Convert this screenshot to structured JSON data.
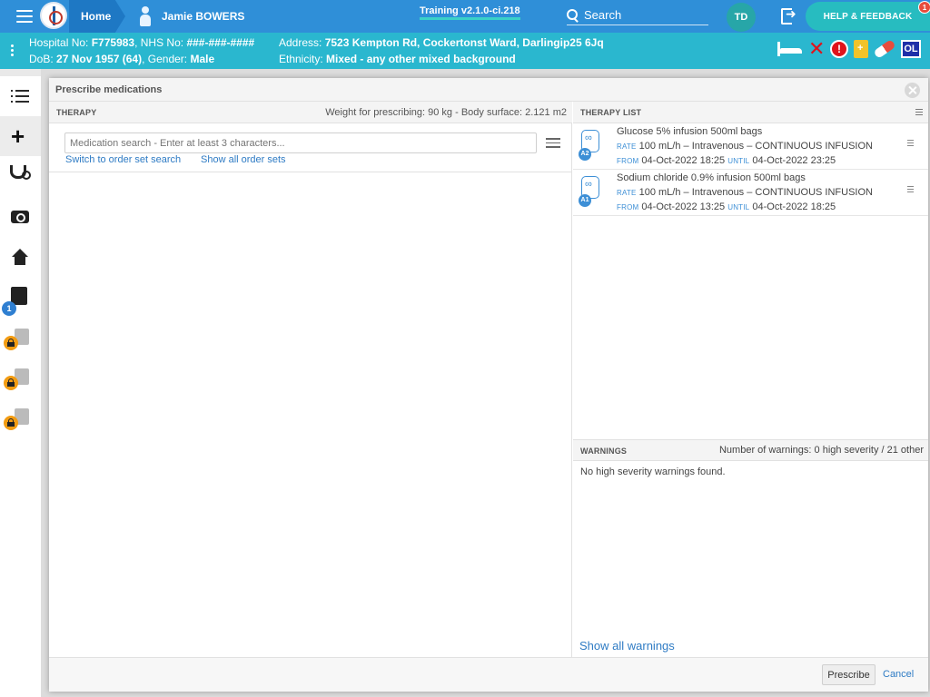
{
  "topbar": {
    "home_label": "Home",
    "patient_name": "Jamie BOWERS",
    "training_label": "Training v2.1.0-ci.218",
    "search_label": "Search",
    "avatar_initials": "TD",
    "help_label": "HELP & FEEDBACK",
    "help_badge": "1"
  },
  "banner": {
    "hospital_no_label": "Hospital No:",
    "hospital_no": "F775983",
    "nhs_no_label": "NHS No:",
    "nhs_no": "###-###-####",
    "address_label": "Address:",
    "address": "7523 Kempton Rd, Cockertonst Ward, Darlingip25 6Jq",
    "dob_label": "DoB:",
    "dob": "27 Nov 1957 (64)",
    "gender_label": "Gender:",
    "gender": "Male",
    "ethnicity_label": "Ethnicity:",
    "ethnicity": "Mixed - any other mixed background",
    "alert_symbol": "!",
    "ol_badge": "OL"
  },
  "rail": {
    "notes_badge": "1"
  },
  "modal": {
    "title": "Prescribe medications",
    "therapy_header": "THERAPY",
    "weight_text": "Weight for prescribing: 90 kg - Body surface: 2.121 m2",
    "search_placeholder": "Medication search - Enter at least 3 characters...",
    "order_set_link": "Switch to order set search",
    "show_sets_link": "Show all order sets",
    "therapy_list_header": "THERAPY LIST",
    "therapies": [
      {
        "badge": "A2",
        "name": "Glucose 5% infusion 500ml bags",
        "rate_label": "RATE",
        "rate": "100 mL/h – Intravenous – CONTINUOUS INFUSION",
        "from_label": "FROM",
        "from": "04-Oct-2022 18:25",
        "until_label": "UNTIL",
        "until": "04-Oct-2022 23:25"
      },
      {
        "badge": "A1",
        "name": "Sodium chloride 0.9% infusion 500ml bags",
        "rate_label": "RATE",
        "rate": "100 mL/h – Intravenous – CONTINUOUS INFUSION",
        "from_label": "FROM",
        "from": "04-Oct-2022 13:25",
        "until_label": "UNTIL",
        "until": "04-Oct-2022 18:25"
      }
    ],
    "warnings_header": "WARNINGS",
    "warnings_count": "Number of warnings: 0 high severity / 21 other",
    "warnings_text": "No high severity warnings found.",
    "show_warnings_link": "Show all warnings",
    "prescribe_label": "Prescribe",
    "cancel_label": "Cancel"
  },
  "colors": {
    "topbar": "#2f8fd8",
    "banner": "#2ab7cf",
    "help": "#27bcc0",
    "link": "#2e7bc4"
  }
}
